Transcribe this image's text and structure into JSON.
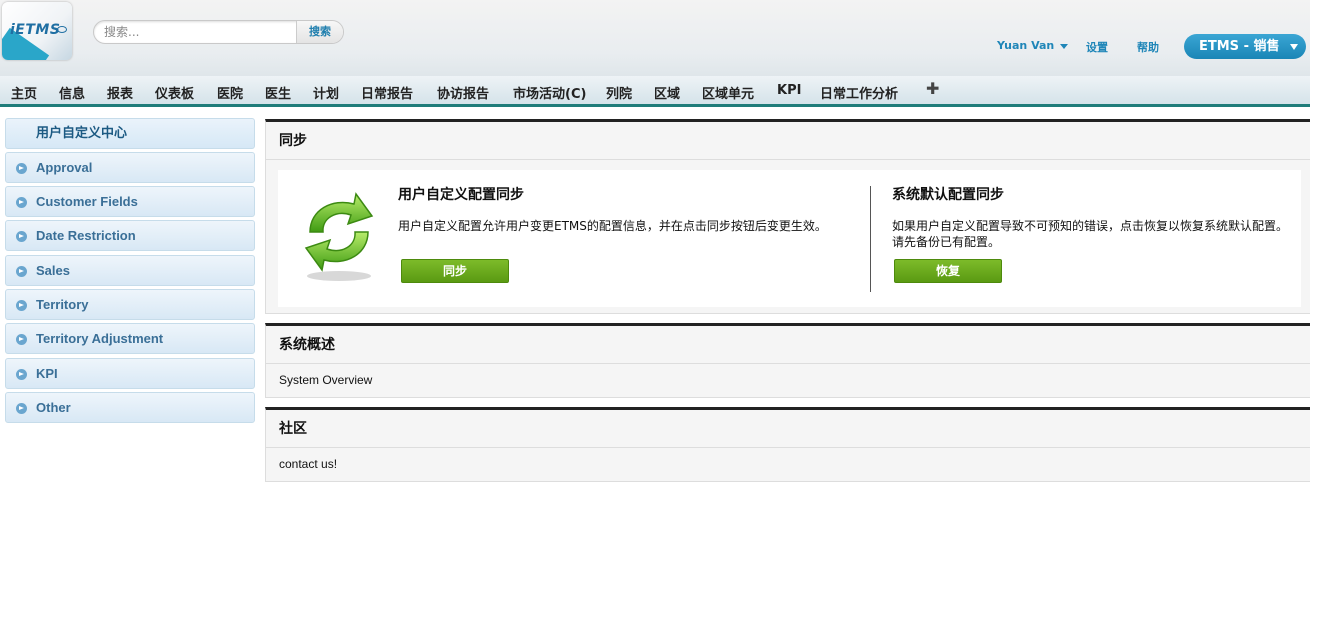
{
  "header": {
    "logo_text": "iETMS",
    "search": {
      "placeholder": "搜索...",
      "button": "搜索"
    },
    "user": "Yuan Van",
    "links": {
      "settings": "设置",
      "help": "帮助"
    },
    "app_switcher": "ETMS - 销售"
  },
  "nav": {
    "items": [
      "主页",
      "信息",
      "报表",
      "仪表板",
      "医院",
      "医生",
      "计划",
      "日常报告",
      "协访报告",
      "市场活动(C)",
      "列院",
      "区域",
      "区域单元",
      "KPI",
      "日常工作分析"
    ],
    "add_icon": "plus-icon"
  },
  "sidebar": {
    "header": "用户自定义中心",
    "items": [
      "Approval",
      "Customer Fields",
      "Date Restriction",
      "Sales",
      "Territory",
      "Territory Adjustment",
      "KPI",
      "Other"
    ]
  },
  "sync_panel": {
    "title": "同步",
    "icon": "sync-arrows-icon",
    "custom": {
      "heading": "用户自定义配置同步",
      "description": "用户自定义配置允许用户变更ETMS的配置信息，并在点击同步按钮后变更生效。",
      "button": "同步"
    },
    "default": {
      "heading": "系统默认配置同步",
      "description": "如果用户自定义配置导致不可预知的错误，点击恢复以恢复系统默认配置。 请先备份已有配置。",
      "button": "恢复"
    }
  },
  "overview_panel": {
    "title": "系统概述",
    "text": "System Overview"
  },
  "community_panel": {
    "title": "社区",
    "text": "contact us!"
  },
  "colors": {
    "accent": "#1f86b8",
    "nav_border": "#1f7c7a",
    "button_green": "#6aab1e"
  }
}
